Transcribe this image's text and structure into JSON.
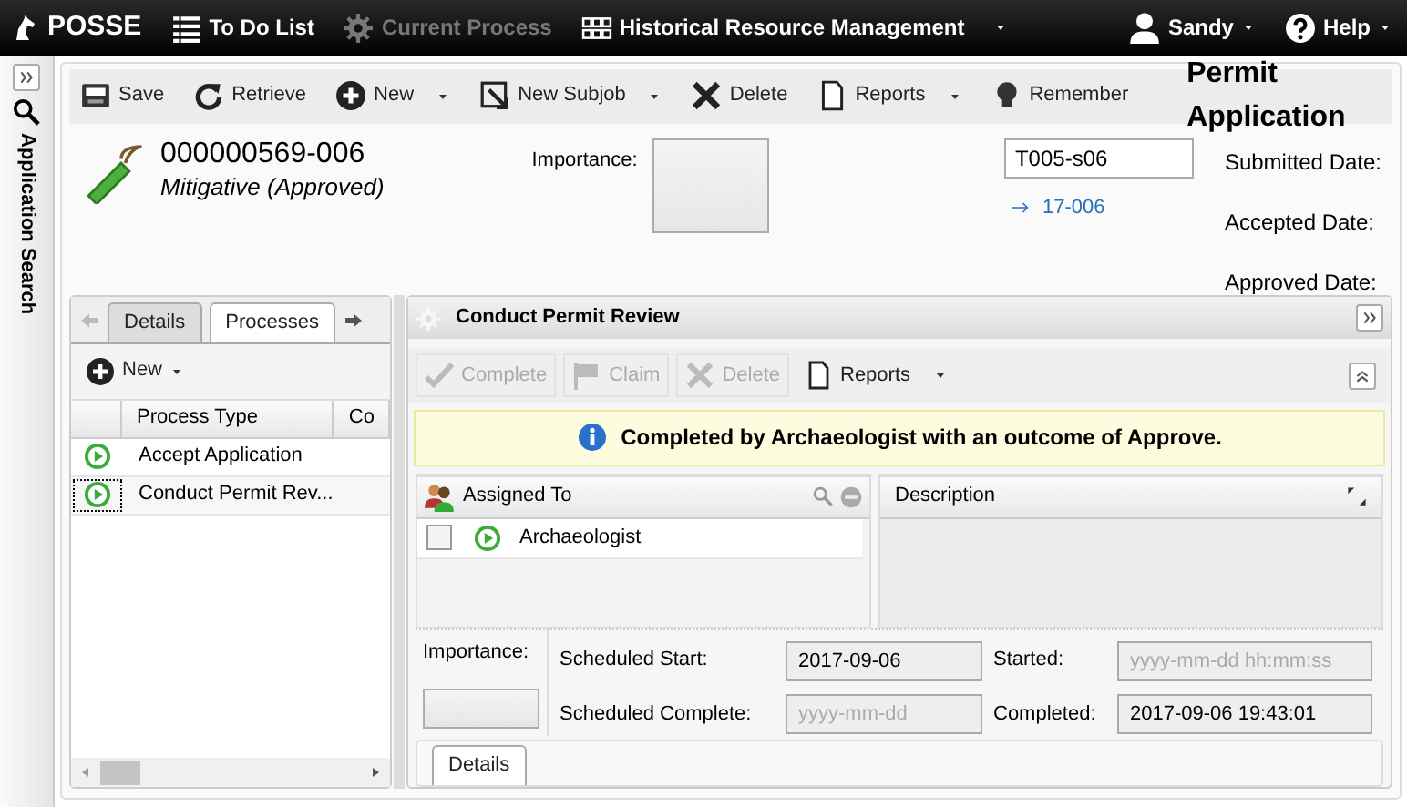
{
  "topnav": {
    "brand": "POSSE",
    "items": [
      {
        "label": "To Do List",
        "disabled": false,
        "dropdown": false
      },
      {
        "label": "Current Process",
        "disabled": true,
        "dropdown": false
      },
      {
        "label": "Historical Resource Management",
        "disabled": false,
        "dropdown": true
      }
    ],
    "user": "Sandy",
    "help": "Help"
  },
  "sidebar": {
    "label": "Application Search"
  },
  "toolbar": {
    "buttons": [
      {
        "label": "Save",
        "dropdown": false
      },
      {
        "label": "Retrieve",
        "dropdown": false
      },
      {
        "label": "New",
        "dropdown": true
      },
      {
        "label": "New Subjob",
        "dropdown": true
      },
      {
        "label": "Delete",
        "dropdown": false
      },
      {
        "label": "Reports",
        "dropdown": true
      },
      {
        "label": "Remember",
        "dropdown": false
      }
    ],
    "title": "Permit Application"
  },
  "record": {
    "number": "000000569-006",
    "status": "Mitigative (Approved)",
    "importance_label": "Importance:",
    "code": "T005-s06",
    "link": "17-006",
    "dates": [
      "Submitted Date:",
      "Accepted Date:",
      "Approved Date:"
    ]
  },
  "left_panel": {
    "tabs": [
      {
        "label": "Details",
        "selected": false
      },
      {
        "label": "Processes",
        "selected": true
      }
    ],
    "new_label": "New",
    "columns": [
      "Process Type",
      "Co"
    ],
    "rows": [
      {
        "process_type": "Accept Application",
        "selected": false
      },
      {
        "process_type": "Conduct Permit Rev...",
        "selected": true
      }
    ]
  },
  "process": {
    "title": "Conduct Permit Review",
    "actions": [
      {
        "label": "Complete",
        "disabled": true,
        "dropdown": false
      },
      {
        "label": "Claim",
        "disabled": true,
        "dropdown": false
      },
      {
        "label": "Delete",
        "disabled": true,
        "dropdown": false
      },
      {
        "label": "Reports",
        "disabled": false,
        "dropdown": true
      }
    ],
    "message": "Completed by Archaeologist with an outcome of Approve.",
    "assigned_header": "Assigned To",
    "assignees": [
      {
        "name": "Archaeologist",
        "checked": false
      }
    ],
    "description_header": "Description",
    "importance_label": "Importance:",
    "fields": [
      {
        "label": "Scheduled Start:",
        "value": "2017-09-06"
      },
      {
        "label": "Started:",
        "placeholder": "yyyy-mm-dd hh:mm:ss"
      },
      {
        "label": "Scheduled Complete:",
        "placeholder": "yyyy-mm-dd"
      },
      {
        "label": "Completed:",
        "value": "2017-09-06 19:43:01"
      }
    ],
    "tabs": [
      {
        "label": "Details",
        "selected": true
      }
    ]
  }
}
